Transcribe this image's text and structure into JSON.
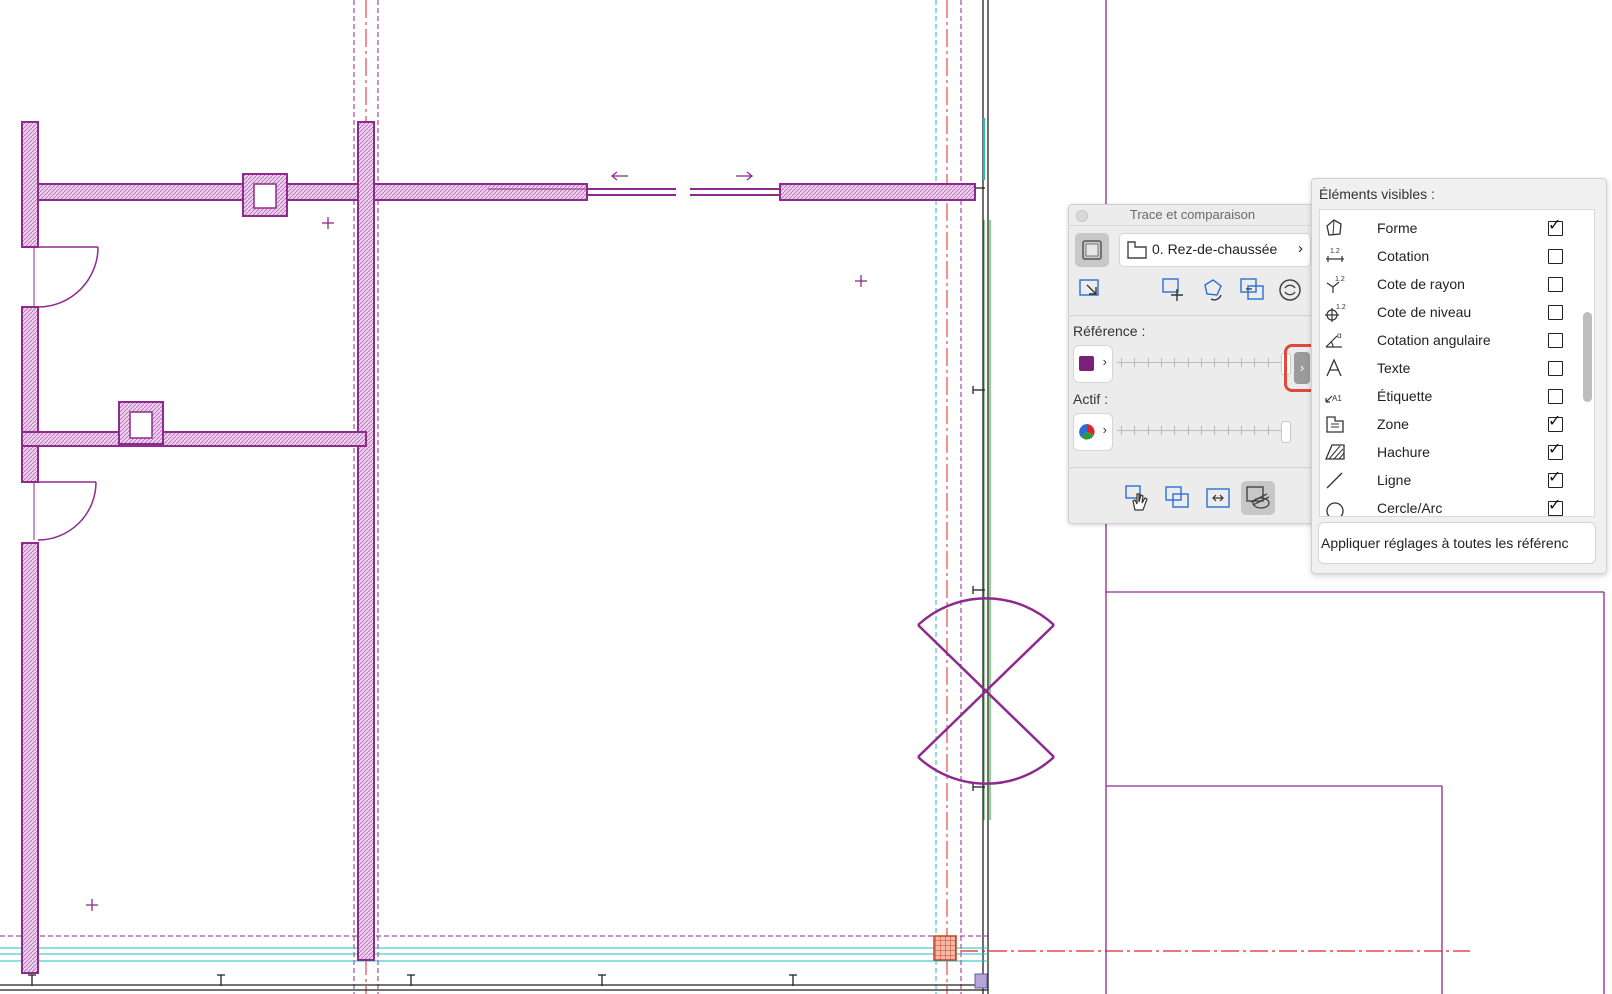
{
  "palette": {
    "title": "Trace et comparaison",
    "story_selector": "0. Rez-de-chaussée",
    "reference_label": "Référence :",
    "active_label": "Actif :",
    "reference_color": "#7a1f7a",
    "reference_slider_value": 1.0,
    "active_slider_value": 1.0
  },
  "visible_elements": {
    "heading": "Éléments visibles :",
    "items": [
      {
        "label": "Forme",
        "icon": "morph-icon",
        "checked": true
      },
      {
        "label": "Cotation",
        "icon": "dimension-icon",
        "checked": false
      },
      {
        "label": "Cote de rayon",
        "icon": "radial-dimension-icon",
        "checked": false
      },
      {
        "label": "Cote de niveau",
        "icon": "level-dimension-icon",
        "checked": false
      },
      {
        "label": "Cotation angulaire",
        "icon": "angle-dimension-icon",
        "checked": false
      },
      {
        "label": "Texte",
        "icon": "text-icon",
        "checked": false
      },
      {
        "label": "Étiquette",
        "icon": "label-icon",
        "checked": false
      },
      {
        "label": "Zone",
        "icon": "zone-icon",
        "checked": true
      },
      {
        "label": "Hachure",
        "icon": "fill-icon",
        "checked": true
      },
      {
        "label": "Ligne",
        "icon": "line-icon",
        "checked": true
      },
      {
        "label": "Cercle/Arc",
        "icon": "arc-icon",
        "checked": true
      }
    ],
    "apply_button": "Appliquer réglages à toutes les référenc"
  },
  "colors": {
    "wall": "#8e2a8e",
    "wall_fill": "#d6a6d6",
    "axis_red": "#e0242a",
    "guide_cyan": "#22bcbc"
  }
}
